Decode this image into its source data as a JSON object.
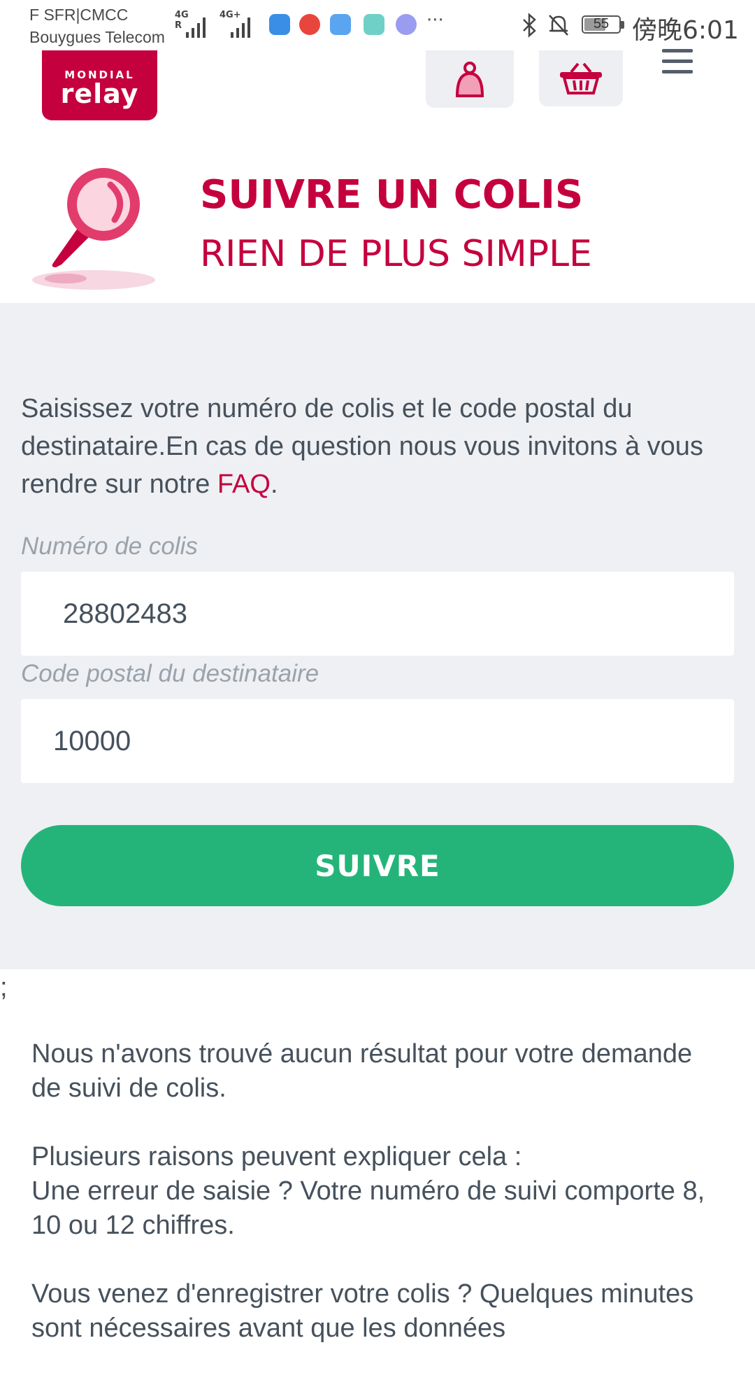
{
  "status_bar": {
    "carrier_line1": "F SFR|CMCC",
    "carrier_line2": "Bouygues Telecom",
    "signal1_label": "4G R",
    "signal2_label": "4G+",
    "more": "···",
    "battery": "55",
    "time": "傍晚6:01"
  },
  "header": {
    "logo_top": "MONDIAL",
    "logo_main": "relay"
  },
  "hero": {
    "title": "SUIVRE UN COLIS",
    "subtitle": "RIEN DE PLUS SIMPLE"
  },
  "form": {
    "intro_text": "Saisissez votre numéro de colis et le code postal du destinataire.En cas de question nous vous invitons à vous rendre sur notre ",
    "faq_link": "FAQ",
    "intro_end": ".",
    "parcel_label": "Numéro de colis",
    "parcel_value": "28802483",
    "postal_label": "Code postal du destinataire",
    "postal_value": "10000",
    "submit_label": "SUIVRE"
  },
  "stray_char": ";",
  "results": {
    "p1": "Nous n'avons trouvé aucun résultat pour votre demande de suivi de colis.",
    "p2_line1": "Plusieurs raisons peuvent expliquer cela :",
    "p2_line2": "Une erreur de saisie ? Votre numéro de suivi comporte 8, 10 ou 12 chiffres.",
    "p3": "Vous venez d'enregistrer votre colis ? Quelques minutes sont nécessaires avant que les données"
  },
  "colors": {
    "brand": "#c5003e",
    "accent_green": "#24b47a",
    "panel_bg": "#eef0f3",
    "text": "#46515c"
  },
  "icons": [
    "bluetooth-icon",
    "mute-bell-icon",
    "user-icon",
    "basket-icon",
    "menu-icon",
    "magnifier-icon"
  ]
}
